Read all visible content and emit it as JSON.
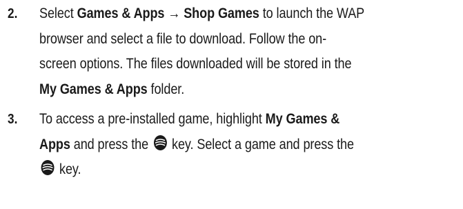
{
  "steps": [
    {
      "number": "2.",
      "lines": [
        [
          {
            "t": "Select ",
            "b": false
          },
          {
            "t": "Games & Apps",
            "b": true
          },
          {
            "t": " → ",
            "b": true,
            "arrow": true
          },
          {
            "t": "Shop Games",
            "b": true
          },
          {
            "t": " to launch the WAP",
            "b": false
          }
        ],
        [
          {
            "t": "browser and select a file to download. Follow the on-",
            "b": false
          }
        ],
        [
          {
            "t": "screen options. The files downloaded will be stored in the",
            "b": false
          }
        ],
        [
          {
            "t": "My Games & Apps",
            "b": true
          },
          {
            "t": " folder.",
            "b": false
          }
        ]
      ]
    },
    {
      "number": "3.",
      "lines": [
        [
          {
            "t": "To access a pre-installed game, highlight ",
            "b": false
          },
          {
            "t": "My Games &",
            "b": true
          }
        ],
        [
          {
            "t": "Apps",
            "b": true
          },
          {
            "t": " and press the ",
            "b": false
          },
          {
            "icon": "select-key-icon"
          },
          {
            "t": " key. Select a game and press the",
            "b": false
          }
        ],
        [
          {
            "icon": "select-key-icon"
          },
          {
            "t": " key.",
            "b": false
          }
        ]
      ]
    }
  ]
}
